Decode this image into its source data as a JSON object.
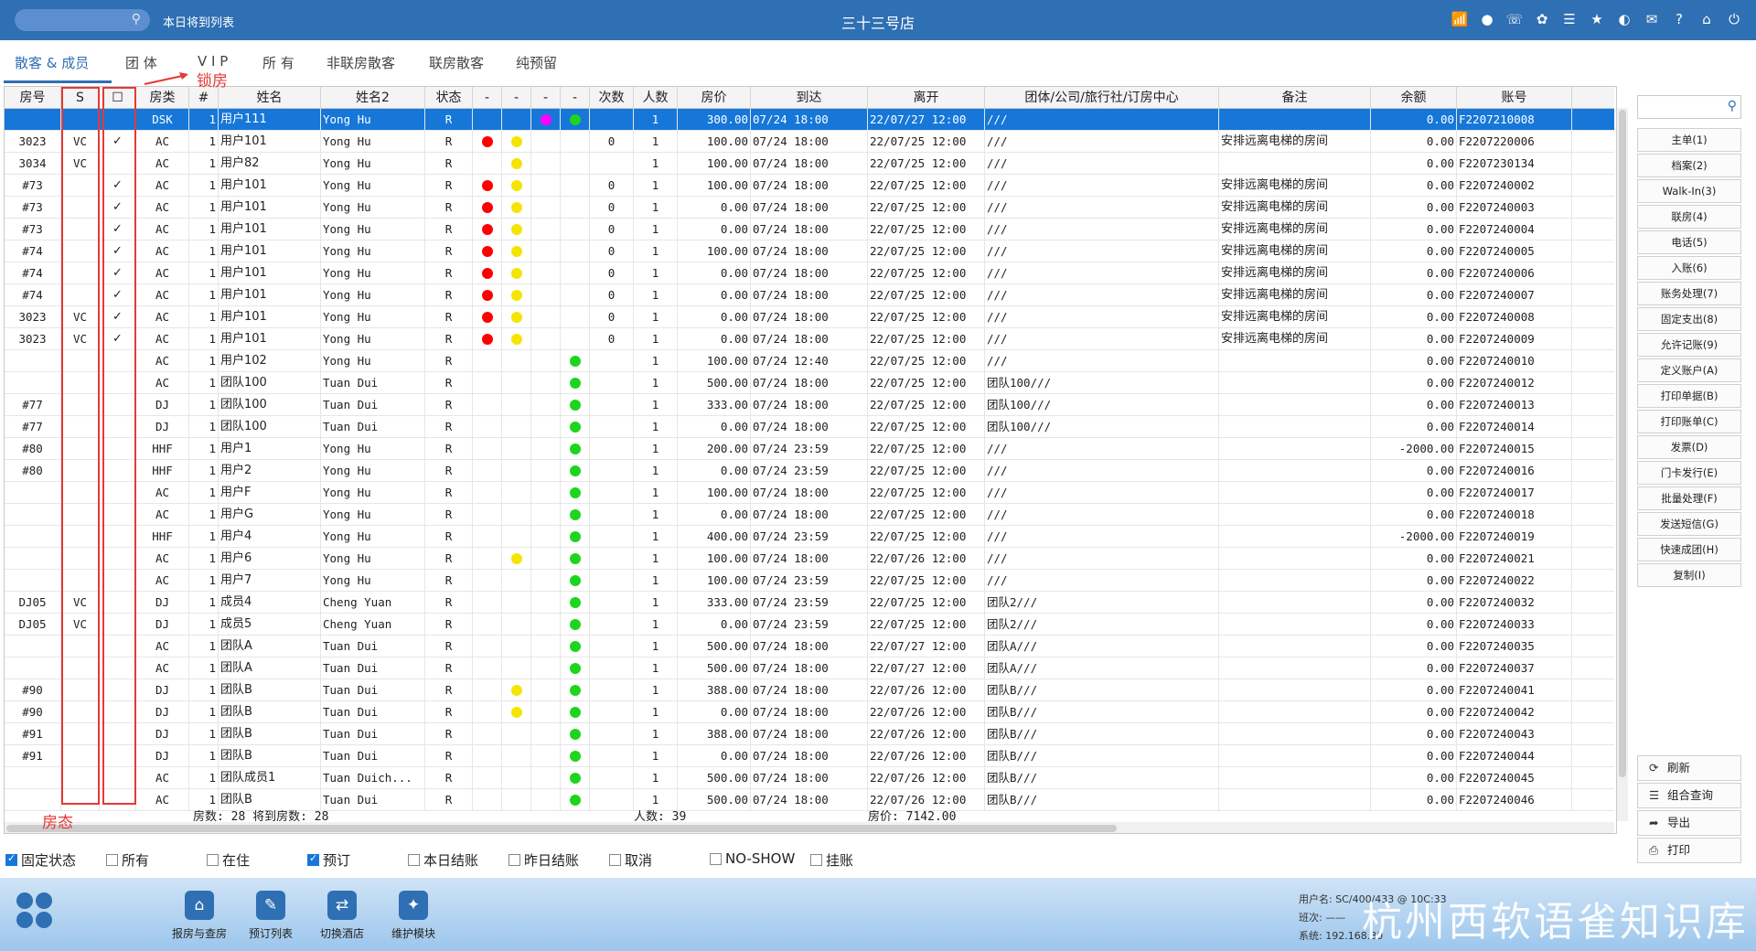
{
  "topbar": {
    "subtitle": "本日将到列表",
    "title": "三十三号店",
    "icons": [
      "wifi-icon",
      "chat-icon",
      "phone-icon",
      "palette-icon",
      "menu-icon",
      "star-icon",
      "theme-icon",
      "mail-icon",
      "help-icon",
      "home-icon",
      "power-icon"
    ]
  },
  "tabs": [
    "散客 & 成员",
    "团 体",
    "V I P",
    "所 有",
    "非联房散客",
    "联房散客",
    "纯预留"
  ],
  "annotations": {
    "lock_room": "锁房",
    "room_status": "房态"
  },
  "columns": [
    "房号",
    "S",
    "☐",
    "房类",
    "#",
    "姓名",
    "姓名2",
    "状态",
    "-",
    "-",
    "-",
    "-",
    "次数",
    "人数",
    "房价",
    "到达",
    "离开",
    "团体/公司/旅行社/订房中心",
    "备注",
    "余额",
    "账号"
  ],
  "rows": [
    {
      "room": "",
      "s": "",
      "lock": "",
      "type": "DSK",
      "n": "1",
      "name": "用户111",
      "name2": "Yong Hu",
      "status": "R",
      "d1": "",
      "d2": "",
      "d3": "magenta",
      "d4": "green",
      "times": "",
      "people": "1",
      "rate": "300.00",
      "arrive": "07/24 18:00",
      "depart": "22/07/27 12:00",
      "group": "///",
      "remark": "",
      "balance": "0.00",
      "account": "F2207210008"
    },
    {
      "room": "3023",
      "s": "VC",
      "lock": "✓",
      "type": "AC",
      "n": "1",
      "name": "用户101",
      "name2": "Yong Hu",
      "status": "R",
      "d1": "red",
      "d2": "yellow",
      "d3": "",
      "d4": "",
      "times": "0",
      "people": "1",
      "rate": "100.00",
      "arrive": "07/24 18:00",
      "depart": "22/07/25 12:00",
      "group": "///",
      "remark": "安排远离电梯的房间",
      "balance": "0.00",
      "account": "F2207220006"
    },
    {
      "room": "3034",
      "s": "VC",
      "lock": "",
      "type": "AC",
      "n": "1",
      "name": "用户82",
      "name2": "Yong Hu",
      "status": "R",
      "d1": "",
      "d2": "yellow",
      "d3": "",
      "d4": "",
      "times": "",
      "people": "1",
      "rate": "100.00",
      "arrive": "07/24 18:00",
      "depart": "22/07/25 12:00",
      "group": "///",
      "remark": "",
      "balance": "0.00",
      "account": "F2207230134"
    },
    {
      "room": "#73",
      "s": "",
      "lock": "✓",
      "type": "AC",
      "n": "1",
      "name": "用户101",
      "name2": "Yong Hu",
      "status": "R",
      "d1": "red",
      "d2": "yellow",
      "d3": "",
      "d4": "",
      "times": "0",
      "people": "1",
      "rate": "100.00",
      "arrive": "07/24 18:00",
      "depart": "22/07/25 12:00",
      "group": "///",
      "remark": "安排远离电梯的房间",
      "balance": "0.00",
      "account": "F2207240002"
    },
    {
      "room": "#73",
      "s": "",
      "lock": "✓",
      "type": "AC",
      "n": "1",
      "name": "用户101",
      "name2": "Yong Hu",
      "status": "R",
      "d1": "red",
      "d2": "yellow",
      "d3": "",
      "d4": "",
      "times": "0",
      "people": "1",
      "rate": "0.00",
      "arrive": "07/24 18:00",
      "depart": "22/07/25 12:00",
      "group": "///",
      "remark": "安排远离电梯的房间",
      "balance": "0.00",
      "account": "F2207240003"
    },
    {
      "room": "#73",
      "s": "",
      "lock": "✓",
      "type": "AC",
      "n": "1",
      "name": "用户101",
      "name2": "Yong Hu",
      "status": "R",
      "d1": "red",
      "d2": "yellow",
      "d3": "",
      "d4": "",
      "times": "0",
      "people": "1",
      "rate": "0.00",
      "arrive": "07/24 18:00",
      "depart": "22/07/25 12:00",
      "group": "///",
      "remark": "安排远离电梯的房间",
      "balance": "0.00",
      "account": "F2207240004"
    },
    {
      "room": "#74",
      "s": "",
      "lock": "✓",
      "type": "AC",
      "n": "1",
      "name": "用户101",
      "name2": "Yong Hu",
      "status": "R",
      "d1": "red",
      "d2": "yellow",
      "d3": "",
      "d4": "",
      "times": "0",
      "people": "1",
      "rate": "100.00",
      "arrive": "07/24 18:00",
      "depart": "22/07/25 12:00",
      "group": "///",
      "remark": "安排远离电梯的房间",
      "balance": "0.00",
      "account": "F2207240005"
    },
    {
      "room": "#74",
      "s": "",
      "lock": "✓",
      "type": "AC",
      "n": "1",
      "name": "用户101",
      "name2": "Yong Hu",
      "status": "R",
      "d1": "red",
      "d2": "yellow",
      "d3": "",
      "d4": "",
      "times": "0",
      "people": "1",
      "rate": "0.00",
      "arrive": "07/24 18:00",
      "depart": "22/07/25 12:00",
      "group": "///",
      "remark": "安排远离电梯的房间",
      "balance": "0.00",
      "account": "F2207240006"
    },
    {
      "room": "#74",
      "s": "",
      "lock": "✓",
      "type": "AC",
      "n": "1",
      "name": "用户101",
      "name2": "Yong Hu",
      "status": "R",
      "d1": "red",
      "d2": "yellow",
      "d3": "",
      "d4": "",
      "times": "0",
      "people": "1",
      "rate": "0.00",
      "arrive": "07/24 18:00",
      "depart": "22/07/25 12:00",
      "group": "///",
      "remark": "安排远离电梯的房间",
      "balance": "0.00",
      "account": "F2207240007"
    },
    {
      "room": "3023",
      "s": "VC",
      "lock": "✓",
      "type": "AC",
      "n": "1",
      "name": "用户101",
      "name2": "Yong Hu",
      "status": "R",
      "d1": "red",
      "d2": "yellow",
      "d3": "",
      "d4": "",
      "times": "0",
      "people": "1",
      "rate": "0.00",
      "arrive": "07/24 18:00",
      "depart": "22/07/25 12:00",
      "group": "///",
      "remark": "安排远离电梯的房间",
      "balance": "0.00",
      "account": "F2207240008"
    },
    {
      "room": "3023",
      "s": "VC",
      "lock": "✓",
      "type": "AC",
      "n": "1",
      "name": "用户101",
      "name2": "Yong Hu",
      "status": "R",
      "d1": "red",
      "d2": "yellow",
      "d3": "",
      "d4": "",
      "times": "0",
      "people": "1",
      "rate": "0.00",
      "arrive": "07/24 18:00",
      "depart": "22/07/25 12:00",
      "group": "///",
      "remark": "安排远离电梯的房间",
      "balance": "0.00",
      "account": "F2207240009"
    },
    {
      "room": "",
      "s": "",
      "lock": "",
      "type": "AC",
      "n": "1",
      "name": "用户102",
      "name2": "Yong Hu",
      "status": "R",
      "d1": "",
      "d2": "",
      "d3": "",
      "d4": "green",
      "times": "",
      "people": "1",
      "rate": "100.00",
      "arrive": "07/24 12:40",
      "depart": "22/07/25 12:00",
      "group": "///",
      "remark": "",
      "balance": "0.00",
      "account": "F2207240010"
    },
    {
      "room": "",
      "s": "",
      "lock": "",
      "type": "AC",
      "n": "1",
      "name": "团队100",
      "name2": "Tuan Dui",
      "status": "R",
      "d1": "",
      "d2": "",
      "d3": "",
      "d4": "green",
      "times": "",
      "people": "1",
      "rate": "500.00",
      "arrive": "07/24 18:00",
      "depart": "22/07/25 12:00",
      "group": "团队100///",
      "remark": "",
      "balance": "0.00",
      "account": "F2207240012"
    },
    {
      "room": "#77",
      "s": "",
      "lock": "",
      "type": "DJ",
      "n": "1",
      "name": "团队100",
      "name2": "Tuan Dui",
      "status": "R",
      "d1": "",
      "d2": "",
      "d3": "",
      "d4": "green",
      "times": "",
      "people": "1",
      "rate": "333.00",
      "arrive": "07/24 18:00",
      "depart": "22/07/25 12:00",
      "group": "团队100///",
      "remark": "",
      "balance": "0.00",
      "account": "F2207240013"
    },
    {
      "room": "#77",
      "s": "",
      "lock": "",
      "type": "DJ",
      "n": "1",
      "name": "团队100",
      "name2": "Tuan Dui",
      "status": "R",
      "d1": "",
      "d2": "",
      "d3": "",
      "d4": "green",
      "times": "",
      "people": "1",
      "rate": "0.00",
      "arrive": "07/24 18:00",
      "depart": "22/07/25 12:00",
      "group": "团队100///",
      "remark": "",
      "balance": "0.00",
      "account": "F2207240014"
    },
    {
      "room": "#80",
      "s": "",
      "lock": "",
      "type": "HHF",
      "n": "1",
      "name": "用户1",
      "name2": "Yong Hu",
      "status": "R",
      "d1": "",
      "d2": "",
      "d3": "",
      "d4": "green",
      "times": "",
      "people": "1",
      "rate": "200.00",
      "arrive": "07/24 23:59",
      "depart": "22/07/25 12:00",
      "group": "///",
      "remark": "",
      "balance": "-2000.00",
      "account": "F2207240015"
    },
    {
      "room": "#80",
      "s": "",
      "lock": "",
      "type": "HHF",
      "n": "1",
      "name": "用户2",
      "name2": "Yong Hu",
      "status": "R",
      "d1": "",
      "d2": "",
      "d3": "",
      "d4": "green",
      "times": "",
      "people": "1",
      "rate": "0.00",
      "arrive": "07/24 23:59",
      "depart": "22/07/25 12:00",
      "group": "///",
      "remark": "",
      "balance": "0.00",
      "account": "F2207240016"
    },
    {
      "room": "",
      "s": "",
      "lock": "",
      "type": "AC",
      "n": "1",
      "name": "用户F",
      "name2": "Yong Hu",
      "status": "R",
      "d1": "",
      "d2": "",
      "d3": "",
      "d4": "green",
      "times": "",
      "people": "1",
      "rate": "100.00",
      "arrive": "07/24 18:00",
      "depart": "22/07/25 12:00",
      "group": "///",
      "remark": "",
      "balance": "0.00",
      "account": "F2207240017"
    },
    {
      "room": "",
      "s": "",
      "lock": "",
      "type": "AC",
      "n": "1",
      "name": "用户G",
      "name2": "Yong Hu",
      "status": "R",
      "d1": "",
      "d2": "",
      "d3": "",
      "d4": "green",
      "times": "",
      "people": "1",
      "rate": "0.00",
      "arrive": "07/24 18:00",
      "depart": "22/07/25 12:00",
      "group": "///",
      "remark": "",
      "balance": "0.00",
      "account": "F2207240018"
    },
    {
      "room": "",
      "s": "",
      "lock": "",
      "type": "HHF",
      "n": "1",
      "name": "用户4",
      "name2": "Yong Hu",
      "status": "R",
      "d1": "",
      "d2": "",
      "d3": "",
      "d4": "green",
      "times": "",
      "people": "1",
      "rate": "400.00",
      "arrive": "07/24 23:59",
      "depart": "22/07/25 12:00",
      "group": "///",
      "remark": "",
      "balance": "-2000.00",
      "account": "F2207240019"
    },
    {
      "room": "",
      "s": "",
      "lock": "",
      "type": "AC",
      "n": "1",
      "name": "用户6",
      "name2": "Yong Hu",
      "status": "R",
      "d1": "",
      "d2": "yellow",
      "d3": "",
      "d4": "green",
      "times": "",
      "people": "1",
      "rate": "100.00",
      "arrive": "07/24 18:00",
      "depart": "22/07/26 12:00",
      "group": "///",
      "remark": "",
      "balance": "0.00",
      "account": "F2207240021"
    },
    {
      "room": "",
      "s": "",
      "lock": "",
      "type": "AC",
      "n": "1",
      "name": "用户7",
      "name2": "Yong Hu",
      "status": "R",
      "d1": "",
      "d2": "",
      "d3": "",
      "d4": "green",
      "times": "",
      "people": "1",
      "rate": "100.00",
      "arrive": "07/24 23:59",
      "depart": "22/07/25 12:00",
      "group": "///",
      "remark": "",
      "balance": "0.00",
      "account": "F2207240022"
    },
    {
      "room": "DJ05",
      "s": "VC",
      "lock": "",
      "type": "DJ",
      "n": "1",
      "name": "成员4",
      "name2": "Cheng Yuan",
      "status": "R",
      "d1": "",
      "d2": "",
      "d3": "",
      "d4": "green",
      "times": "",
      "people": "1",
      "rate": "333.00",
      "arrive": "07/24 23:59",
      "depart": "22/07/25 12:00",
      "group": "团队2///",
      "remark": "",
      "balance": "0.00",
      "account": "F2207240032"
    },
    {
      "room": "DJ05",
      "s": "VC",
      "lock": "",
      "type": "DJ",
      "n": "1",
      "name": "成员5",
      "name2": "Cheng Yuan",
      "status": "R",
      "d1": "",
      "d2": "",
      "d3": "",
      "d4": "green",
      "times": "",
      "people": "1",
      "rate": "0.00",
      "arrive": "07/24 23:59",
      "depart": "22/07/25 12:00",
      "group": "团队2///",
      "remark": "",
      "balance": "0.00",
      "account": "F2207240033"
    },
    {
      "room": "",
      "s": "",
      "lock": "",
      "type": "AC",
      "n": "1",
      "name": "团队A",
      "name2": "Tuan Dui",
      "status": "R",
      "d1": "",
      "d2": "",
      "d3": "",
      "d4": "green",
      "times": "",
      "people": "1",
      "rate": "500.00",
      "arrive": "07/24 18:00",
      "depart": "22/07/27 12:00",
      "group": "团队A///",
      "remark": "",
      "balance": "0.00",
      "account": "F2207240035"
    },
    {
      "room": "",
      "s": "",
      "lock": "",
      "type": "AC",
      "n": "1",
      "name": "团队A",
      "name2": "Tuan Dui",
      "status": "R",
      "d1": "",
      "d2": "",
      "d3": "",
      "d4": "green",
      "times": "",
      "people": "1",
      "rate": "500.00",
      "arrive": "07/24 18:00",
      "depart": "22/07/27 12:00",
      "group": "团队A///",
      "remark": "",
      "balance": "0.00",
      "account": "F2207240037"
    },
    {
      "room": "#90",
      "s": "",
      "lock": "",
      "type": "DJ",
      "n": "1",
      "name": "团队B",
      "name2": "Tuan Dui",
      "status": "R",
      "d1": "",
      "d2": "yellow",
      "d3": "",
      "d4": "green",
      "times": "",
      "people": "1",
      "rate": "388.00",
      "arrive": "07/24 18:00",
      "depart": "22/07/26 12:00",
      "group": "团队B///",
      "remark": "",
      "balance": "0.00",
      "account": "F2207240041"
    },
    {
      "room": "#90",
      "s": "",
      "lock": "",
      "type": "DJ",
      "n": "1",
      "name": "团队B",
      "name2": "Tuan Dui",
      "status": "R",
      "d1": "",
      "d2": "yellow",
      "d3": "",
      "d4": "green",
      "times": "",
      "people": "1",
      "rate": "0.00",
      "arrive": "07/24 18:00",
      "depart": "22/07/26 12:00",
      "group": "团队B///",
      "remark": "",
      "balance": "0.00",
      "account": "F2207240042"
    },
    {
      "room": "#91",
      "s": "",
      "lock": "",
      "type": "DJ",
      "n": "1",
      "name": "团队B",
      "name2": "Tuan Dui",
      "status": "R",
      "d1": "",
      "d2": "",
      "d3": "",
      "d4": "green",
      "times": "",
      "people": "1",
      "rate": "388.00",
      "arrive": "07/24 18:00",
      "depart": "22/07/26 12:00",
      "group": "团队B///",
      "remark": "",
      "balance": "0.00",
      "account": "F2207240043"
    },
    {
      "room": "#91",
      "s": "",
      "lock": "",
      "type": "DJ",
      "n": "1",
      "name": "团队B",
      "name2": "Tuan Dui",
      "status": "R",
      "d1": "",
      "d2": "",
      "d3": "",
      "d4": "green",
      "times": "",
      "people": "1",
      "rate": "0.00",
      "arrive": "07/24 18:00",
      "depart": "22/07/26 12:00",
      "group": "团队B///",
      "remark": "",
      "balance": "0.00",
      "account": "F2207240044"
    },
    {
      "room": "",
      "s": "",
      "lock": "",
      "type": "AC",
      "n": "1",
      "name": "团队成员1",
      "name2": "Tuan Duich...",
      "status": "R",
      "d1": "",
      "d2": "",
      "d3": "",
      "d4": "green",
      "times": "",
      "people": "1",
      "rate": "500.00",
      "arrive": "07/24 18:00",
      "depart": "22/07/26 12:00",
      "group": "团队B///",
      "remark": "",
      "balance": "0.00",
      "account": "F2207240045"
    },
    {
      "room": "",
      "s": "",
      "lock": "",
      "type": "AC",
      "n": "1",
      "name": "团队B",
      "name2": "Tuan Dui",
      "status": "R",
      "d1": "",
      "d2": "",
      "d3": "",
      "d4": "green",
      "times": "",
      "people": "1",
      "rate": "500.00",
      "arrive": "07/24 18:00",
      "depart": "22/07/26 12:00",
      "group": "团队B///",
      "remark": "",
      "balance": "0.00",
      "account": "F2207240046"
    }
  ],
  "summary": {
    "rooms": "房数: 28 将到房数: 28",
    "people": "人数: 39",
    "rate": "房价: 7142.00"
  },
  "right_buttons": [
    "主单(1)",
    "档案(2)",
    "Walk-In(3)",
    "联房(4)",
    "电话(5)",
    "入账(6)",
    "账务处理(7)",
    "固定支出(8)",
    "允许记账(9)",
    "定义账户(A)",
    "打印单据(B)",
    "打印账单(C)",
    "发票(D)",
    "门卡发行(E)",
    "批量处理(F)",
    "发送短信(G)",
    "快速成团(H)",
    "复制(I)"
  ],
  "right_actions": [
    {
      "icon": "refresh-icon",
      "glyph": "⟳",
      "label": "刷新"
    },
    {
      "icon": "list-icon",
      "glyph": "☰",
      "label": "组合查询"
    },
    {
      "icon": "export-icon",
      "glyph": "➦",
      "label": "导出"
    },
    {
      "icon": "print-icon",
      "glyph": "⎙",
      "label": "打印"
    }
  ],
  "filters": [
    {
      "label": "固定状态",
      "checked": true
    },
    {
      "label": "所有",
      "checked": false
    },
    {
      "label": "在住",
      "checked": false
    },
    {
      "label": "预订",
      "checked": true
    },
    {
      "label": "本日结账",
      "checked": false
    },
    {
      "label": "昨日结账",
      "checked": false
    },
    {
      "label": "取消",
      "checked": false
    },
    {
      "label": "NO-SHOW",
      "checked": false
    },
    {
      "label": "挂账",
      "checked": false
    }
  ],
  "modules": [
    {
      "icon": "house-search-icon",
      "glyph": "⌂",
      "label": "报房与查房"
    },
    {
      "icon": "booking-list-icon",
      "glyph": "✎",
      "label": "预订列表"
    },
    {
      "icon": "switch-hotel-icon",
      "glyph": "⇄",
      "label": "切换酒店"
    },
    {
      "icon": "wrench-icon",
      "glyph": "✦",
      "label": "维护模块"
    }
  ],
  "system_info": [
    "用户名: SC/400/433 @ 10C:33",
    "班次: ——",
    "系统: 192.168.30"
  ],
  "watermark": "杭州西软语雀知识库",
  "colors": {
    "accent": "#2f6fb3",
    "selected_row": "#1677d9",
    "annotation": "#e53935",
    "dot_red": "#ff0000",
    "dot_yellow": "#f5e400",
    "dot_green": "#1ed41e",
    "dot_magenta": "#ff00ff"
  }
}
